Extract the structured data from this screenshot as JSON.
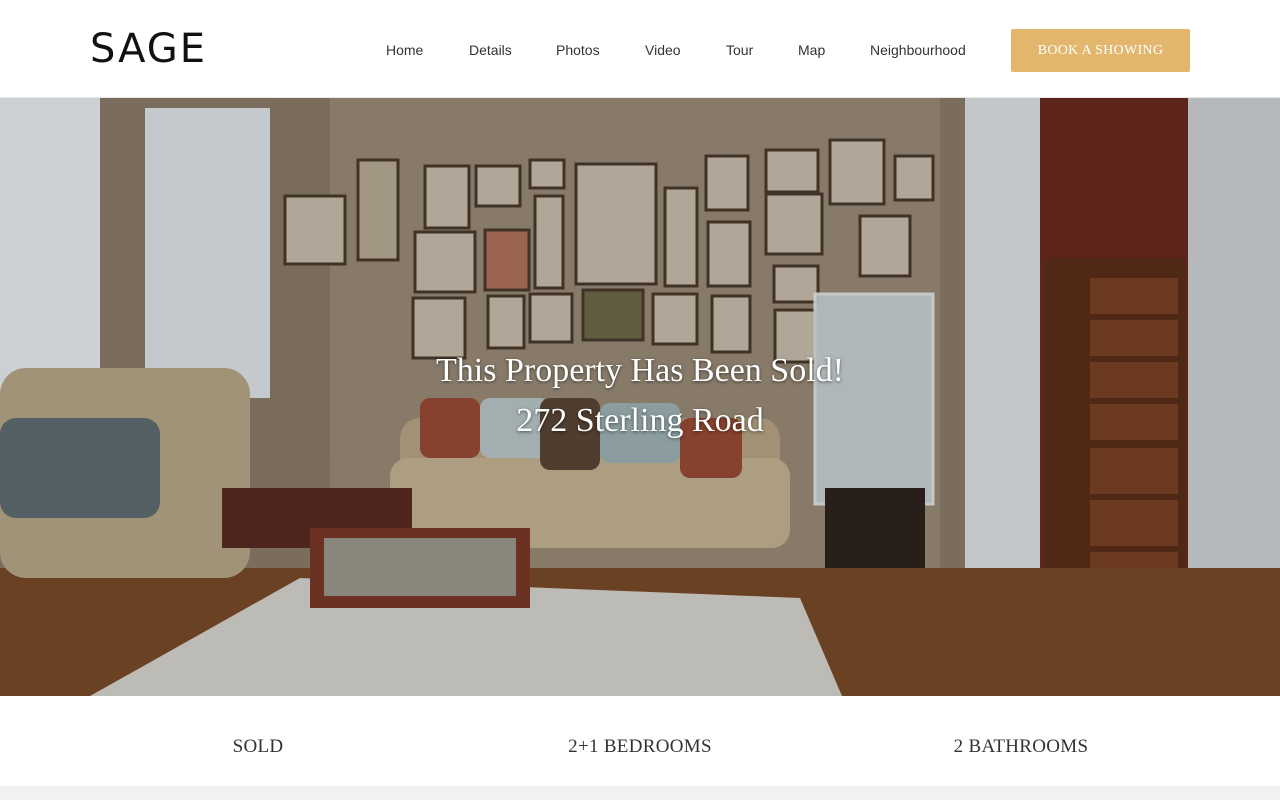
{
  "brand": {
    "logo_text": "SAGE"
  },
  "nav": {
    "items": [
      {
        "label": "Home"
      },
      {
        "label": "Details"
      },
      {
        "label": "Photos"
      },
      {
        "label": "Video"
      },
      {
        "label": "Tour"
      },
      {
        "label": "Map"
      },
      {
        "label": "Neighbourhood"
      }
    ],
    "cta_label": "BOOK A SHOWING"
  },
  "hero": {
    "headline": "This Property Has Been Sold!",
    "address": "272 Sterling Road",
    "image_description_icon": "living-room-photo"
  },
  "stats": [
    {
      "label": "SOLD"
    },
    {
      "label": "2+1 BEDROOMS"
    },
    {
      "label": "2 BATHROOMS"
    }
  ],
  "colors": {
    "accent": "#e2b66c",
    "header_bg": "#ffffff",
    "text": "#333333"
  }
}
